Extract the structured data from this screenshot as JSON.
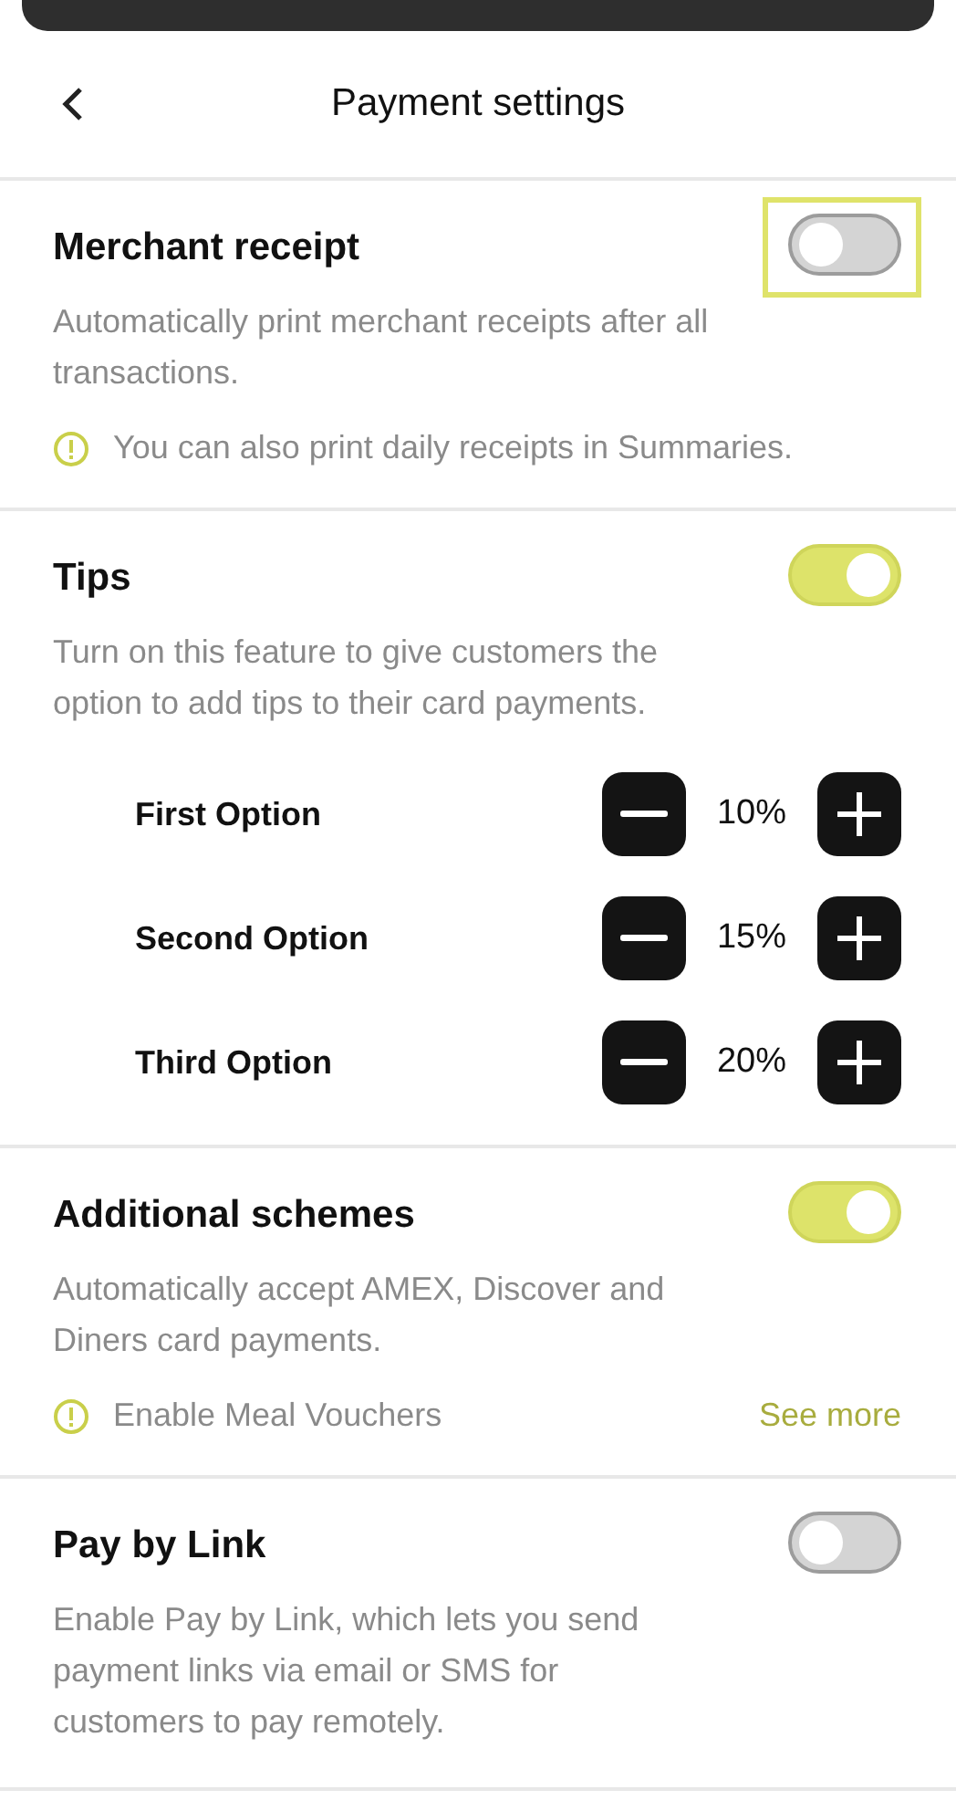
{
  "header": {
    "title": "Payment settings"
  },
  "sections": [
    {
      "title": "Merchant receipt",
      "on": false,
      "highlighted": true,
      "description": "Automatically print merchant receipts after all transactions.",
      "note": {
        "text": "You can also print daily receipts in Summaries."
      }
    },
    {
      "title": "Tips",
      "on": true,
      "highlighted": false,
      "description": "Turn on this feature to give customers the option to add tips to their card payments.",
      "options": [
        {
          "label": "First Option",
          "value": "10%"
        },
        {
          "label": "Second Option",
          "value": "15%"
        },
        {
          "label": "Third Option",
          "value": "20%"
        }
      ]
    },
    {
      "title": "Additional schemes",
      "on": true,
      "highlighted": false,
      "description": "Automatically accept AMEX, Discover and Diners card payments.",
      "note": {
        "text": "Enable Meal Vouchers",
        "link": "See more"
      }
    },
    {
      "title": "Pay by Link",
      "on": false,
      "highlighted": false,
      "description": "Enable Pay by Link, which lets you send payment links via email or SMS for customers to pay remotely."
    }
  ]
}
